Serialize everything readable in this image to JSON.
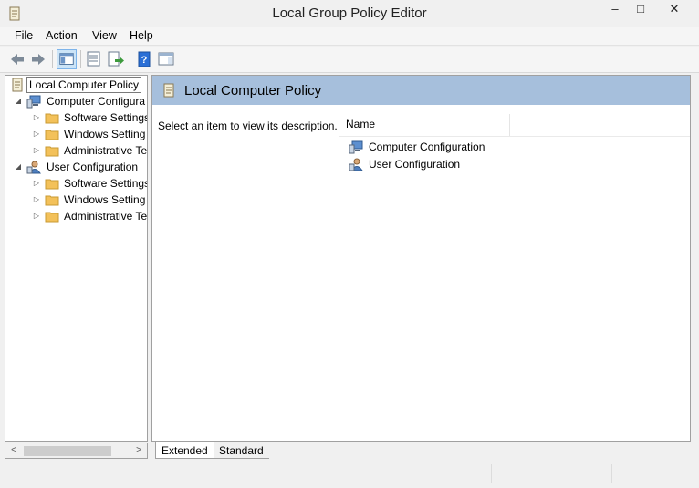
{
  "window": {
    "title": "Local Group Policy Editor",
    "icons": [
      "policy-scroll-icon"
    ],
    "controls": {
      "minimize": "–",
      "maximize": "□",
      "close": "✕"
    }
  },
  "menu": {
    "file": "File",
    "action": "Action",
    "view": "View",
    "help": "Help"
  },
  "toolbar": {
    "icons": [
      "back-arrow-icon",
      "forward-arrow-icon",
      "show-hide-console-tree-icon",
      "properties-icon",
      "export-list-icon",
      "help-icon",
      "show-hide-action-pane-icon"
    ]
  },
  "tree": {
    "root": "Local Computer Policy",
    "computer": {
      "label": "Computer Configura",
      "children": [
        "Software Settings",
        "Windows Setting",
        "Administrative Te"
      ]
    },
    "user": {
      "label": "User Configuration",
      "children": [
        "Software Settings",
        "Windows Setting",
        "Administrative Te"
      ]
    }
  },
  "details": {
    "header": "Local Computer Policy",
    "description": "Select an item to view its description.",
    "column_name": "Name",
    "items": [
      "Computer Configuration",
      "User Configuration"
    ]
  },
  "tabs": {
    "extended": "Extended",
    "standard": "Standard"
  },
  "colors": {
    "header_band": "#a6bfdc",
    "folder": "#f3c15a",
    "help_blue": "#2a6fd6"
  }
}
